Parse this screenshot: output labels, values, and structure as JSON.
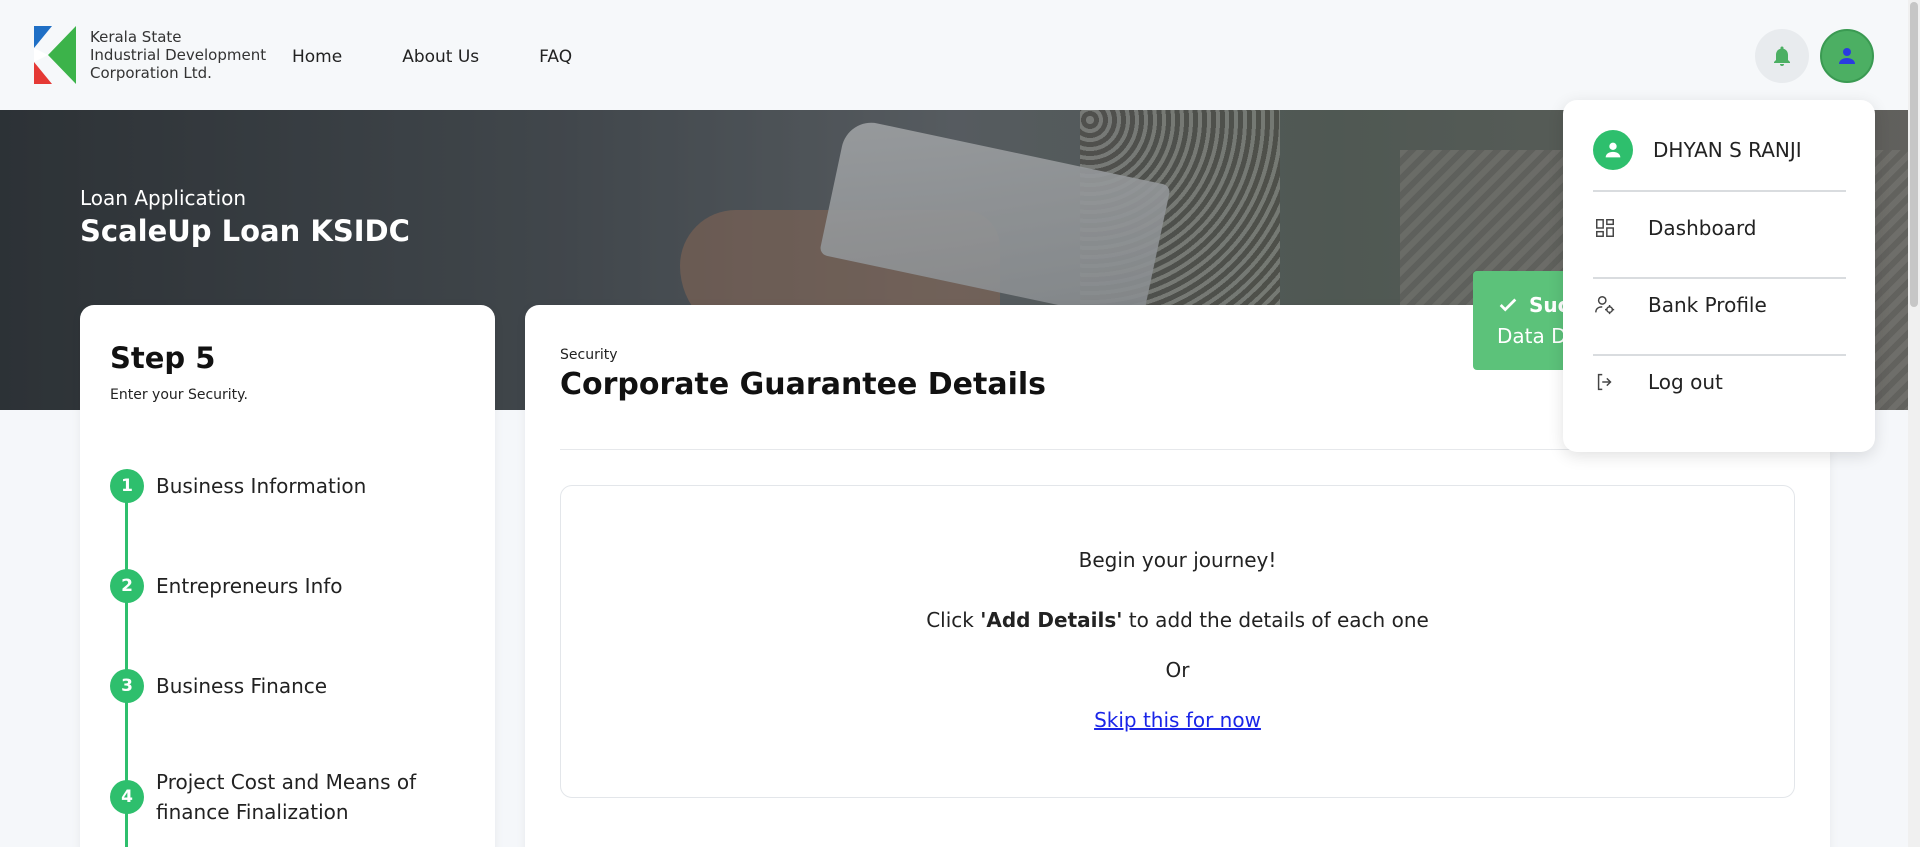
{
  "brand": {
    "logo_icon": "ksidc-k-logo",
    "line1": "Kerala State",
    "line2": "Industrial Development",
    "line3": "Corporation Ltd."
  },
  "nav": {
    "home": "Home",
    "about": "About Us",
    "faq": "FAQ"
  },
  "header_icons": {
    "bell": "bell-icon",
    "user": "user-icon"
  },
  "hero": {
    "subtitle": "Loan Application",
    "title": "ScaleUp Loan KSIDC"
  },
  "steps_panel": {
    "title": "Step 5",
    "description": "Enter your Security.",
    "items": [
      {
        "num": "1",
        "label": "Business Information"
      },
      {
        "num": "2",
        "label": "Entrepreneurs Info"
      },
      {
        "num": "3",
        "label": "Business Finance"
      },
      {
        "num": "4",
        "label_line1": "Project Cost and Means of",
        "label_line2": "finance Finalization"
      }
    ]
  },
  "main": {
    "section_label": "Security",
    "section_title": "Corporate Guarantee Details",
    "journey": {
      "heading": "Begin your journey!",
      "line_prefix": "Click ",
      "line_bold": "'Add Details'",
      "line_suffix": " to add the details of each one",
      "or": "Or",
      "skip_link": "Skip this for now"
    }
  },
  "toast": {
    "title": "Suc",
    "message": "Data D",
    "icon": "check-icon",
    "color": "#5cc27a"
  },
  "user_menu": {
    "name": "DHYAN S RANJI",
    "items": [
      {
        "label": "Dashboard",
        "icon": "dashboard-icon"
      },
      {
        "label": "Bank Profile",
        "icon": "user-settings-icon"
      },
      {
        "label": "Log out",
        "icon": "logout-icon"
      }
    ]
  },
  "colors": {
    "accent_green": "#2ebf6d",
    "link_blue": "#1a25e8",
    "background": "#f5f7fa"
  }
}
